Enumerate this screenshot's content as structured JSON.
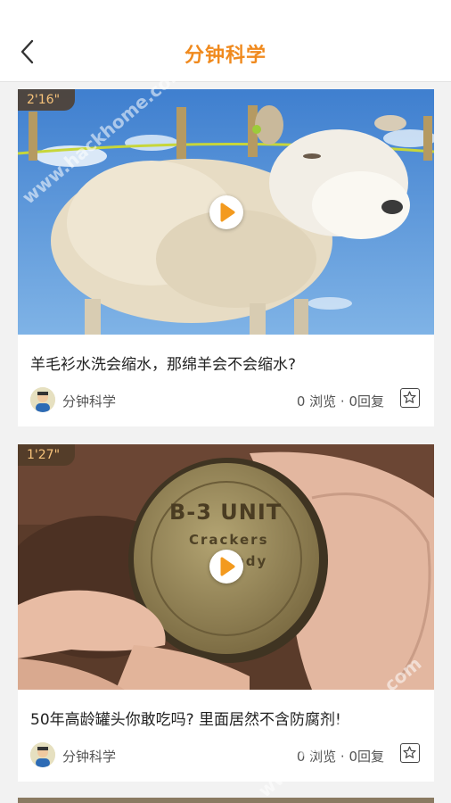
{
  "header": {
    "title": "分钟科学",
    "back_icon": "chevron-left-icon"
  },
  "feed": [
    {
      "duration": "2'16\"",
      "caption": "羊毛衫水洗会缩水，那绵羊会不会缩水?",
      "author": "分钟科学",
      "stats": "0 浏览 · 0回复",
      "fav_icon": "star-icon"
    },
    {
      "duration": "1'27\"",
      "caption": "50年高龄罐头你敢吃吗? 里面居然不含防腐剂!",
      "author": "分钟科学",
      "stats": "0 浏览 · 0回复",
      "fav_icon": "star-icon",
      "can_text_top": "B-3 UNIT",
      "can_text_mid": "Crackers",
      "can_text_low": "Candy"
    }
  ],
  "watermark": "www.hackhome.com",
  "colors": {
    "accent": "#f08a1e",
    "play": "#f39a1f"
  }
}
